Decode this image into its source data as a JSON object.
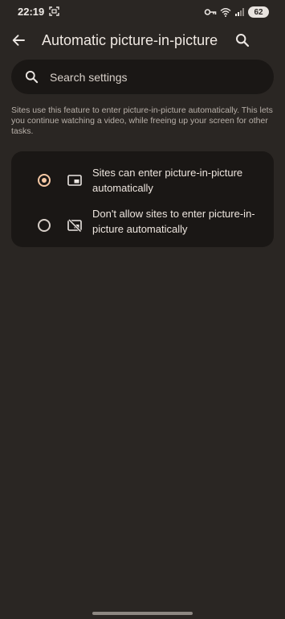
{
  "status_bar": {
    "time": "22:19",
    "battery": "62"
  },
  "header": {
    "title": "Automatic picture-in-picture"
  },
  "search": {
    "placeholder": "Search settings"
  },
  "description": "Sites use this feature to enter picture-in-picture automatically. This lets you continue watching a video, while freeing up your screen for other tasks.",
  "options": [
    {
      "label": "Sites can enter picture-in-picture automatically",
      "selected": true,
      "icon": "picture-in-picture-icon"
    },
    {
      "label": "Don't allow sites to enter picture-in-picture automatically",
      "selected": false,
      "icon": "picture-in-picture-off-icon"
    }
  ],
  "colors": {
    "background": "#2a2623",
    "surface": "#1a1715",
    "accent": "#f6c8a4",
    "text": "#ede5de"
  }
}
